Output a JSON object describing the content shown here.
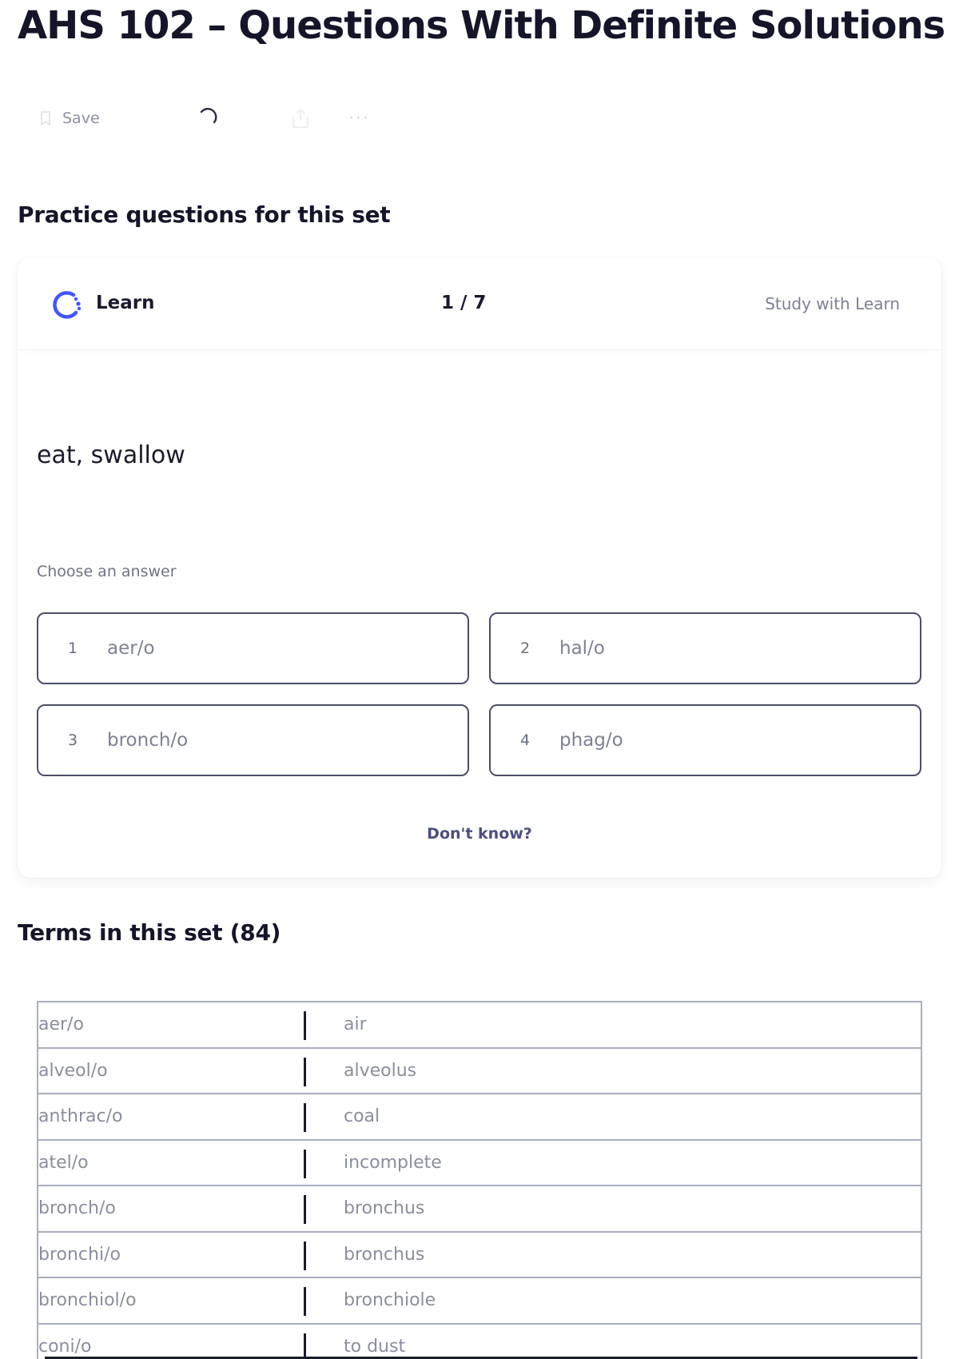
{
  "title": "AHS 102 – Questions With Definite Solutions",
  "toolbar": {
    "save_label": "Save",
    "icons": [
      "bookmark-icon",
      "loading-spinner-icon",
      "share-icon",
      "more-icon"
    ],
    "more_label": "···"
  },
  "practice": {
    "heading": "Practice questions for this set",
    "mode_label": "Learn",
    "progress": "1 / 7",
    "study_link": "Study with Learn",
    "prompt": "eat, swallow",
    "choose_label": "Choose an answer",
    "options": [
      {
        "number": "1",
        "text": "aer/o"
      },
      {
        "number": "2",
        "text": "hal/o"
      },
      {
        "number": "3",
        "text": "bronch/o"
      },
      {
        "number": "4",
        "text": "phag/o"
      }
    ],
    "dont_know": "Don't know?"
  },
  "terms": {
    "heading": "Terms in this set (84)",
    "rows": [
      {
        "term": "aer/o",
        "definition": "air"
      },
      {
        "term": "alveol/o",
        "definition": "alveolus"
      },
      {
        "term": "anthrac/o",
        "definition": "coal"
      },
      {
        "term": "atel/o",
        "definition": "incomplete"
      },
      {
        "term": "bronch/o",
        "definition": "bronchus"
      },
      {
        "term": "bronchi/o",
        "definition": "bronchus"
      },
      {
        "term": "bronchiol/o",
        "definition": "bronchiole"
      },
      {
        "term": "coni/o",
        "definition": "to dust"
      }
    ]
  },
  "colors": {
    "accent": "#4255ff",
    "text": "#1b1b2e",
    "muted": "#8b8e9f",
    "option_border": "#4b4e67"
  }
}
